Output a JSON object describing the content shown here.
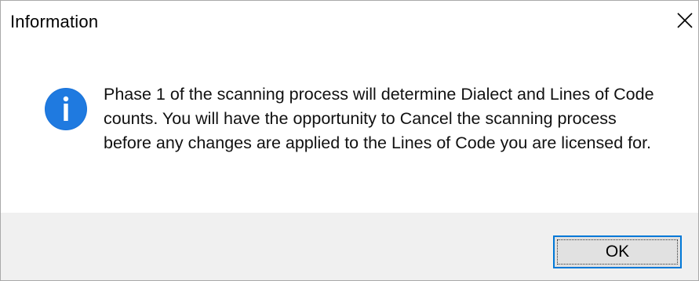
{
  "dialog": {
    "title": "Information",
    "close_icon": "close-icon",
    "icon": "info-icon",
    "message": "Phase 1 of the scanning process will determine Dialect and Lines of Code counts. You will have the opportunity to Cancel the scanning process before any changes are applied to the Lines of Code you are licensed for.",
    "ok_label": "OK"
  },
  "colors": {
    "info_icon": "#1a73d9",
    "button_focus_border": "#0078d7",
    "footer_bg": "#f0f0f0"
  }
}
